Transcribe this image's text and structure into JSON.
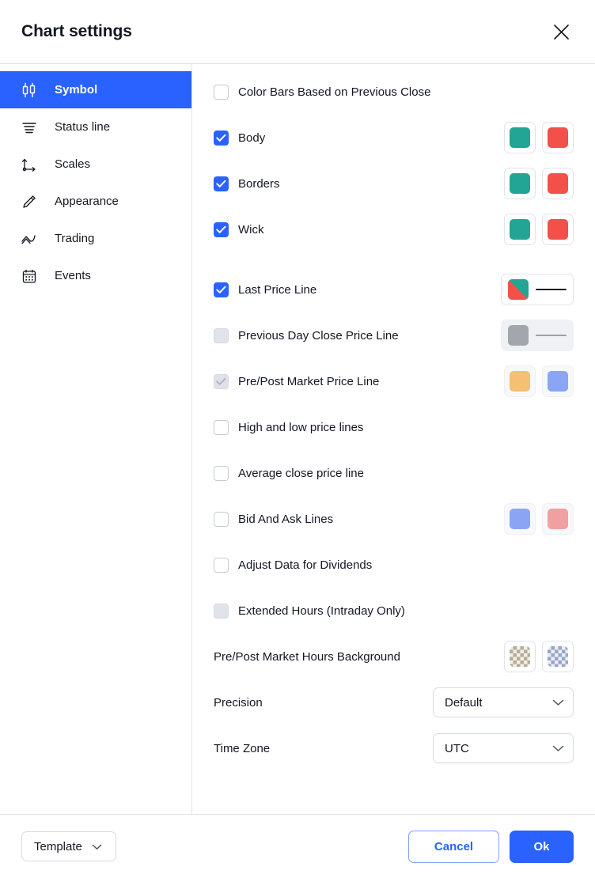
{
  "header": {
    "title": "Chart settings",
    "close_icon": "close-icon"
  },
  "sidebar": {
    "items": [
      {
        "label": "Symbol",
        "icon": "candlestick-icon",
        "active": true
      },
      {
        "label": "Status line",
        "icon": "status-line-icon",
        "active": false
      },
      {
        "label": "Scales",
        "icon": "scales-axis-icon",
        "active": false
      },
      {
        "label": "Appearance",
        "icon": "pencil-icon",
        "active": false
      },
      {
        "label": "Trading",
        "icon": "trading-wave-icon",
        "active": false
      },
      {
        "label": "Events",
        "icon": "calendar-icon",
        "active": false
      }
    ]
  },
  "colors": {
    "accent": "#2962ff",
    "up_green": "#22a594",
    "down_red": "#f4504a",
    "disabled_grey": "#a3a6ad",
    "pre_market_orange": "#f5c073",
    "post_market_blue": "#8ba5f5",
    "bid_blue": "#8ba5f5",
    "ask_red": "#f0a0a0",
    "last_price_line": "#131722"
  },
  "main": {
    "rows": [
      {
        "label": "Color Bars Based on Previous Close",
        "checkbox": "unchecked",
        "controls": "none"
      },
      {
        "label": "Body",
        "checkbox": "checked",
        "controls": "two-colors"
      },
      {
        "label": "Borders",
        "checkbox": "checked",
        "controls": "two-colors"
      },
      {
        "label": "Wick",
        "checkbox": "checked",
        "controls": "two-colors"
      },
      {
        "label": "Last Price Line",
        "checkbox": "checked",
        "controls": "split-line"
      },
      {
        "label": "Previous Day Close Price Line",
        "checkbox": "disabled-unchecked",
        "controls": "grey-line"
      },
      {
        "label": "Pre/Post Market Price Line",
        "checkbox": "disabled-checked",
        "controls": "two-colors-prepost"
      },
      {
        "label": "High and low price lines",
        "checkbox": "unchecked",
        "controls": "none"
      },
      {
        "label": "Average close price line",
        "checkbox": "unchecked",
        "controls": "none"
      },
      {
        "label": "Bid And Ask Lines",
        "checkbox": "unchecked",
        "controls": "two-colors-bidask"
      },
      {
        "label": "Adjust Data for Dividends",
        "checkbox": "unchecked",
        "controls": "none"
      },
      {
        "label": "Extended Hours (Intraday Only)",
        "checkbox": "disabled-unchecked",
        "controls": "none"
      }
    ],
    "background_row": {
      "label": "Pre/Post Market Hours Background",
      "swatch_a": "checkerboard-tan",
      "swatch_b": "checkerboard-blue"
    },
    "precision": {
      "label": "Precision",
      "value": "Default"
    },
    "timezone": {
      "label": "Time Zone",
      "value": "UTC"
    }
  },
  "footer": {
    "template_label": "Template",
    "cancel_label": "Cancel",
    "ok_label": "Ok"
  }
}
